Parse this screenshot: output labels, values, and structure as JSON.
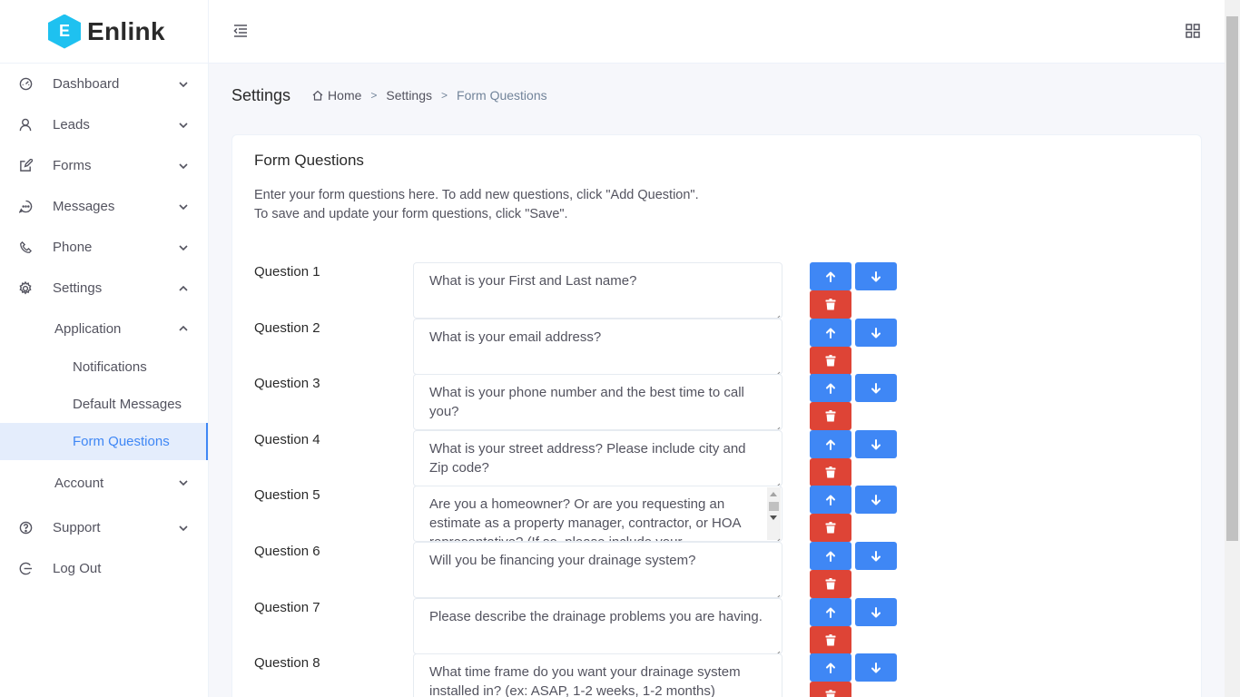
{
  "brand": {
    "name": "Enlink",
    "initial": "E"
  },
  "sidebar": {
    "items": [
      {
        "label": "Dashboard",
        "icon": "dashboard-icon"
      },
      {
        "label": "Leads",
        "icon": "user-icon"
      },
      {
        "label": "Forms",
        "icon": "edit-icon"
      },
      {
        "label": "Messages",
        "icon": "message-icon"
      },
      {
        "label": "Phone",
        "icon": "phone-icon"
      },
      {
        "label": "Settings",
        "icon": "gear-icon"
      }
    ],
    "application_label": "Application",
    "application_children": [
      {
        "label": "Notifications"
      },
      {
        "label": "Default Messages"
      },
      {
        "label": "Form Questions"
      }
    ],
    "account_label": "Account",
    "bottom_items": [
      {
        "label": "Support",
        "icon": "question-icon"
      },
      {
        "label": "Log Out",
        "icon": "logout-icon"
      }
    ]
  },
  "page": {
    "title": "Settings",
    "breadcrumb": {
      "home": "Home",
      "settings": "Settings",
      "current": "Form Questions"
    }
  },
  "card": {
    "title": "Form Questions",
    "desc_line1": "Enter your form questions here. To add new questions, click \"Add Question\".",
    "desc_line2": "To save and update your form questions, click \"Save\"."
  },
  "questions": [
    {
      "label": "Question 1",
      "text": "What is your First and Last name?"
    },
    {
      "label": "Question 2",
      "text": "What is your email address?"
    },
    {
      "label": "Question 3",
      "text": "What is your phone number and the best time to call you?"
    },
    {
      "label": "Question 4",
      "text": "What is your street address? Please include city and Zip code?"
    },
    {
      "label": "Question 5",
      "text": "Are you a homeowner? Or are you requesting an estimate as a property manager, contractor, or HOA representative? (If so, please include your"
    },
    {
      "label": "Question 6",
      "text": "Will you be financing your drainage system?"
    },
    {
      "label": "Question 7",
      "text": "Please describe the drainage problems you are having."
    },
    {
      "label": "Question 8",
      "text": "What time frame do you want your drainage system installed in? (ex: ASAP, 1-2 weeks, 1-2 months)"
    }
  ],
  "colors": {
    "primary": "#3f87f5",
    "danger": "#de4436",
    "active_bg": "#e4edfc"
  }
}
